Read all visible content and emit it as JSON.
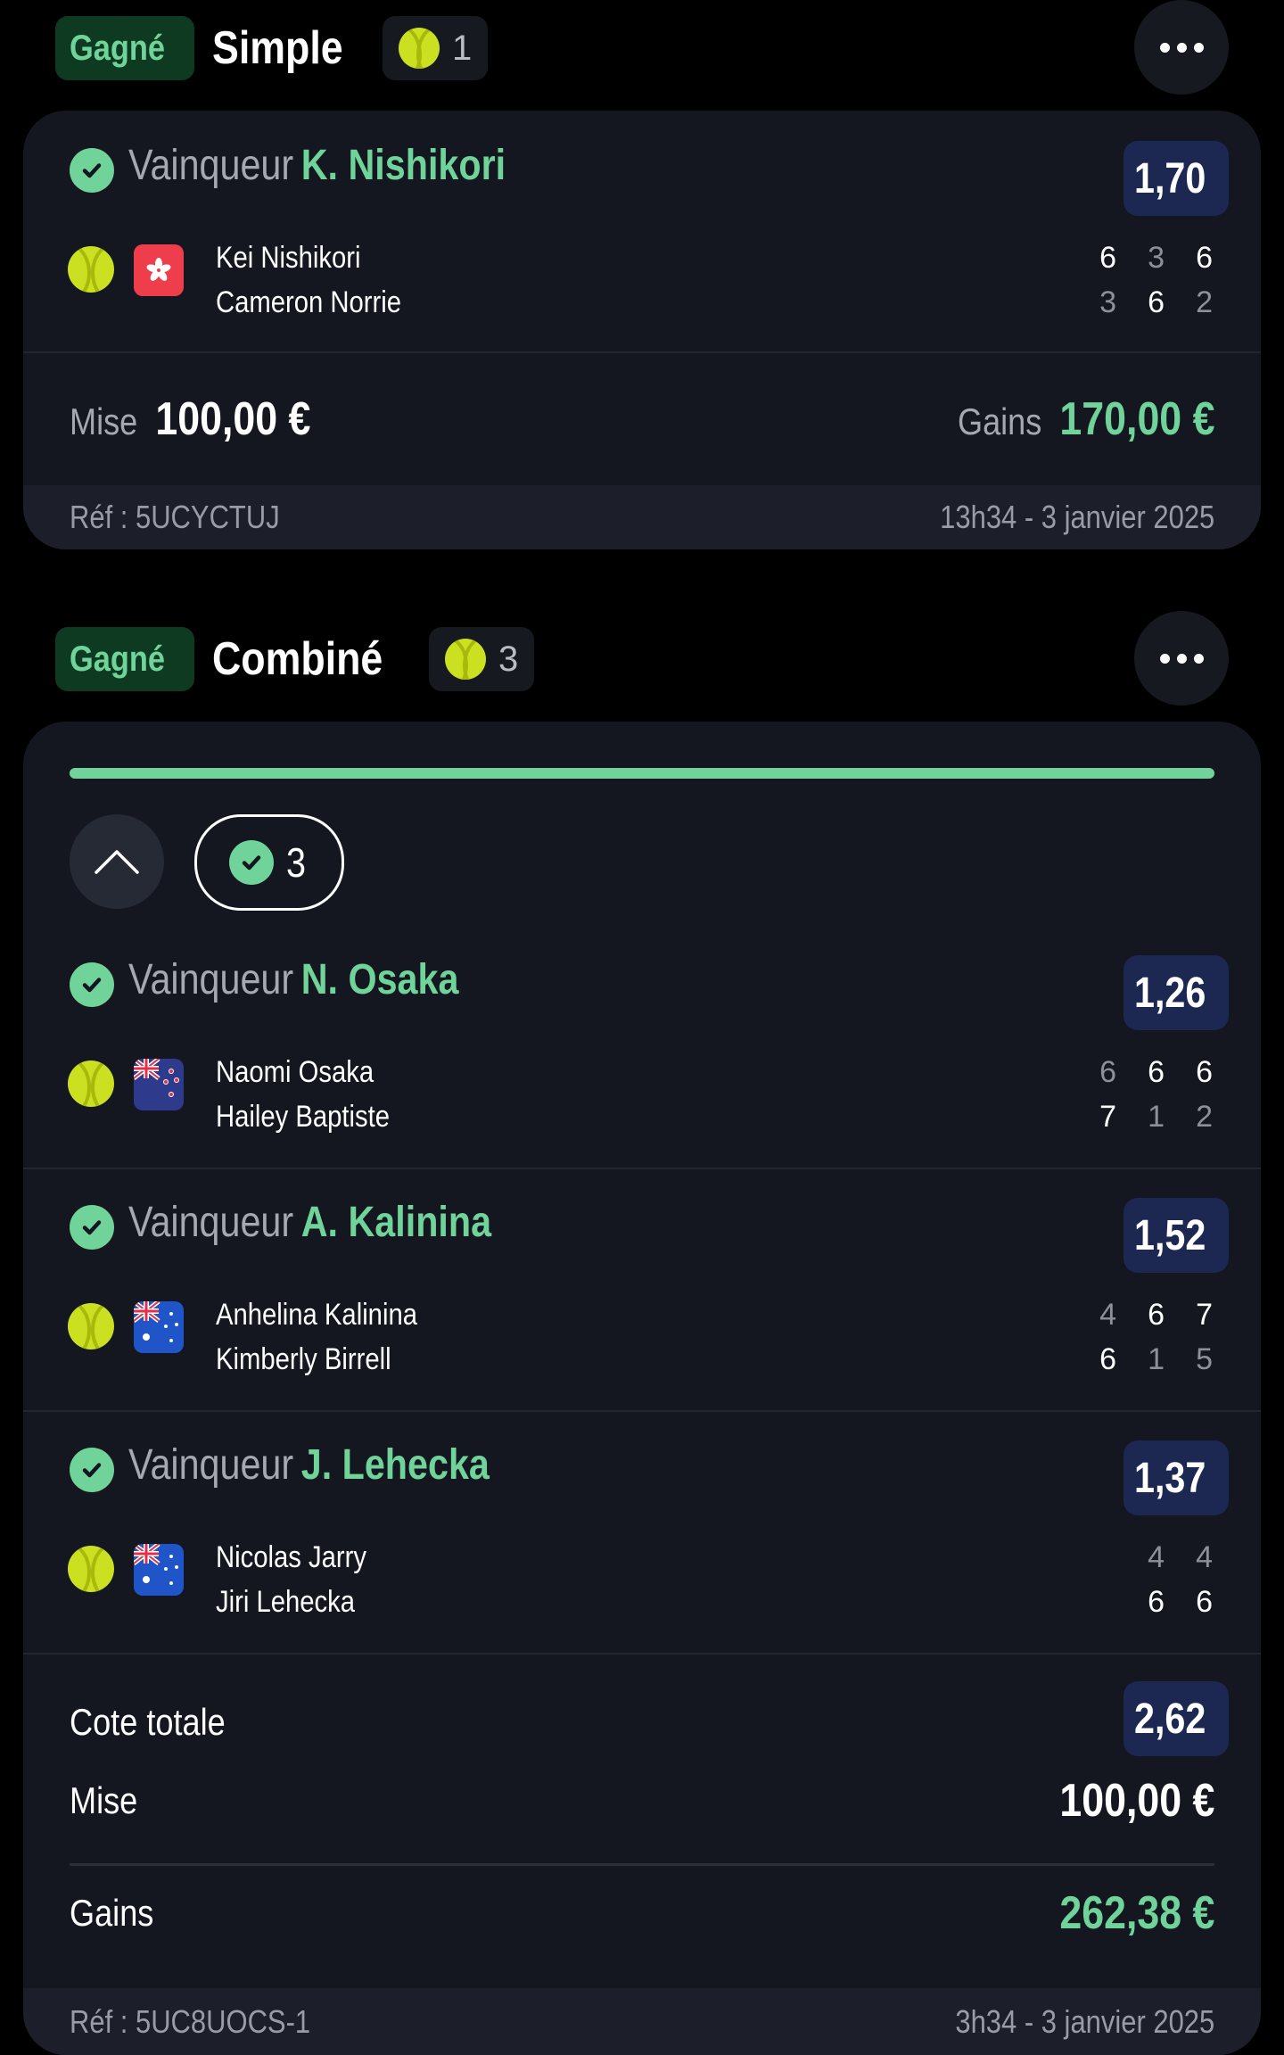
{
  "bets": [
    {
      "status": "Gagné",
      "type": "Simple",
      "count": "1",
      "selections": [
        {
          "label": "Vainqueur",
          "winner": "K. Nishikori",
          "odds": "1,70",
          "flag": "hk",
          "players": [
            "Kei Nishikori",
            "Cameron Norrie"
          ],
          "sets": [
            [
              "6",
              "3",
              "6"
            ],
            [
              "3",
              "6",
              "2"
            ]
          ]
        }
      ],
      "stake_label": "Mise",
      "stake": "100,00 €",
      "gains_label": "Gains",
      "gains": "170,00 €",
      "ref": "Réf : 5UCYCTUJ",
      "datetime": "13h34 - 3 janvier 2025"
    },
    {
      "status": "Gagné",
      "type": "Combiné",
      "count": "3",
      "progress": 1.0,
      "won_count": "3",
      "selections": [
        {
          "label": "Vainqueur",
          "winner": "N. Osaka",
          "odds": "1,26",
          "flag": "nz",
          "players": [
            "Naomi Osaka",
            "Hailey Baptiste"
          ],
          "sets": [
            [
              "6",
              "6",
              "6"
            ],
            [
              "7",
              "1",
              "2"
            ]
          ]
        },
        {
          "label": "Vainqueur",
          "winner": "A. Kalinina",
          "odds": "1,52",
          "flag": "au",
          "players": [
            "Anhelina Kalinina",
            "Kimberly Birrell"
          ],
          "sets": [
            [
              "4",
              "6",
              "7"
            ],
            [
              "6",
              "1",
              "5"
            ]
          ]
        },
        {
          "label": "Vainqueur",
          "winner": "J. Lehecka",
          "odds": "1,37",
          "flag": "au",
          "players": [
            "Nicolas Jarry",
            "Jiri Lehecka"
          ],
          "sets": [
            [
              "4",
              "4"
            ],
            [
              "6",
              "6"
            ]
          ]
        }
      ],
      "total_odds_label": "Cote totale",
      "total_odds": "2,62",
      "stake_label": "Mise",
      "stake": "100,00 €",
      "gains_label": "Gains",
      "gains": "262,38 €",
      "ref": "Réf : 5UC8UOCS-1",
      "datetime": "3h34 - 3 janvier 2025"
    }
  ],
  "colors": {
    "background": "#000000",
    "card": "#141720",
    "accent_green": "#6fd39a",
    "odds_bg": "#1c2752",
    "won_badge_bg": "#0f3a22"
  },
  "icons": [
    "tennis-ball-icon",
    "check-circle-icon",
    "more-dots-icon",
    "chevron-up-icon",
    "flag-hong-kong-icon",
    "flag-new-zealand-icon",
    "flag-australia-icon"
  ]
}
